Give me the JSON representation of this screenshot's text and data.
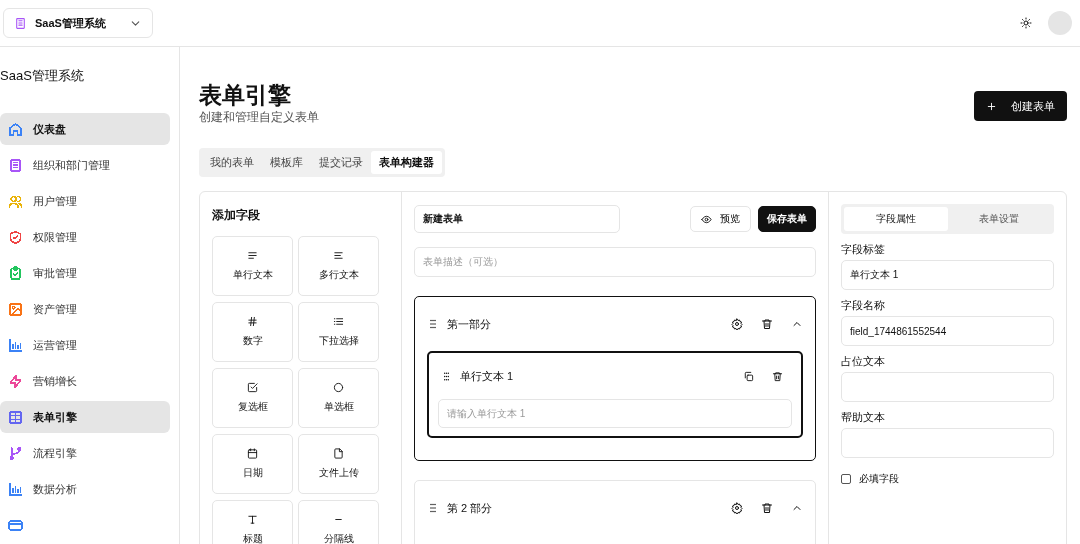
{
  "top_bar": {
    "app_switcher": {
      "label": "SaaS管理系统"
    }
  },
  "sidebar": {
    "title": "SaaS管理系统",
    "items": [
      {
        "label": "仪表盘",
        "color": "#3b82f6",
        "selected": true
      },
      {
        "label": "组织和部门管理",
        "color": "#a855f7",
        "selected": false
      },
      {
        "label": "用户管理",
        "color": "#eab308",
        "selected": false
      },
      {
        "label": "权限管理",
        "color": "#ef4444",
        "selected": false
      },
      {
        "label": "审批管理",
        "color": "#22c55e",
        "selected": false
      },
      {
        "label": "资产管理",
        "color": "#f97316",
        "selected": false
      },
      {
        "label": "运营管理",
        "color": "#3b82f6",
        "selected": false
      },
      {
        "label": "营销增长",
        "color": "#ec4899",
        "selected": false
      },
      {
        "label": "表单引擎",
        "color": "#6366f1",
        "selected": true
      },
      {
        "label": "流程引擎",
        "color": "#a855f7",
        "selected": false
      },
      {
        "label": "数据分析",
        "color": "#3b82f6",
        "selected": false
      },
      {
        "color": "#3b82f6",
        "selected": false
      }
    ]
  },
  "page": {
    "title": "表单引擎",
    "subtitle": "创建和管理自定义表单",
    "create_button": {
      "label": "创建表单"
    },
    "tabs": [
      {
        "label": "我的表单",
        "selected": false
      },
      {
        "label": "模板库",
        "selected": false
      },
      {
        "label": "提交记录",
        "selected": false
      },
      {
        "label": "表单构建器",
        "selected": true
      }
    ]
  },
  "field_palette": {
    "title": "添加字段",
    "items": [
      {
        "label": "单行文本"
      },
      {
        "label": "多行文本"
      },
      {
        "label": "数字"
      },
      {
        "label": "下拉选择"
      },
      {
        "label": "复选框"
      },
      {
        "label": "单选框"
      },
      {
        "label": "日期"
      },
      {
        "label": "文件上传"
      },
      {
        "label": "标题"
      },
      {
        "label": "分隔线"
      }
    ]
  },
  "builder": {
    "form_name": "新建表单",
    "preview_button": "预览",
    "save_button": "保存表单",
    "description_placeholder": "表单描述（可选）",
    "sections": [
      {
        "title": "第一部分",
        "selected": true,
        "expanded": true,
        "fields": [
          {
            "label": "单行文本 1",
            "placeholder": "请输入单行文本 1",
            "selected": true
          }
        ]
      },
      {
        "title": "第 2 部分",
        "selected": false,
        "expanded": true
      }
    ]
  },
  "properties": {
    "tabs": [
      {
        "label": "字段属性",
        "selected": true
      },
      {
        "label": "表单设置",
        "selected": false
      }
    ],
    "fields": [
      {
        "label": "字段标签",
        "value": "单行文本 1"
      },
      {
        "label": "字段名称",
        "value": "field_1744861552544"
      },
      {
        "label": "占位文本"
      },
      {
        "label": "帮助文本"
      }
    ],
    "required": {
      "label": "必填字段",
      "checked": false
    }
  }
}
